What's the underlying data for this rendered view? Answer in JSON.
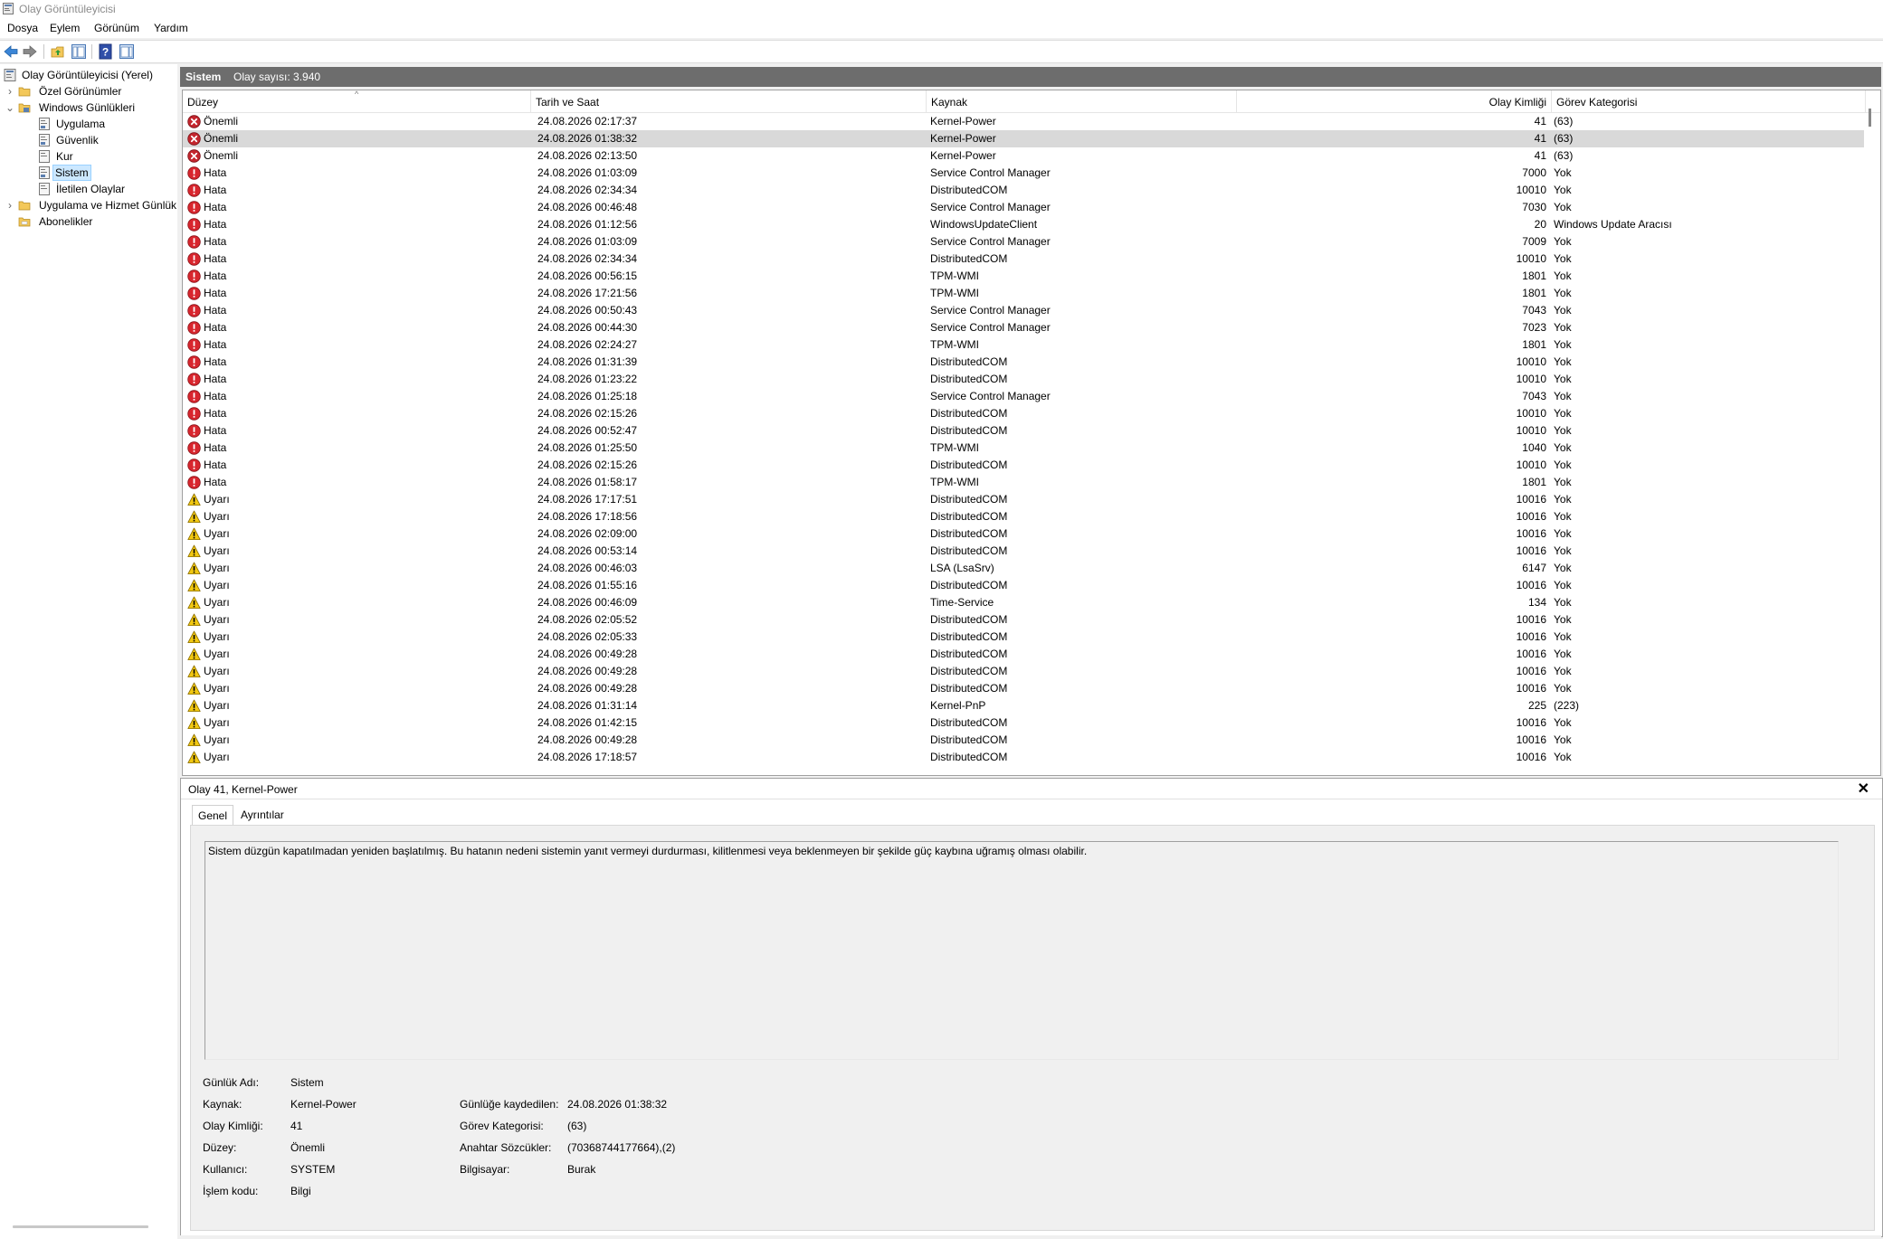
{
  "window": {
    "title": "Olay Görüntüleyicisi"
  },
  "menu": {
    "items": [
      "Dosya",
      "Eylem",
      "Görünüm",
      "Yardım"
    ]
  },
  "toolbar": {
    "buttons": [
      "back-icon",
      "forward-icon",
      "folder-up-icon",
      "show-hide-tree-icon",
      "help-icon",
      "show-hide-action-pane-icon"
    ]
  },
  "tree": {
    "root": "Olay Görüntüleyicisi (Yerel)",
    "custom_views": "Özel Görünümler",
    "windows_logs": "Windows Günlükleri",
    "log_application": "Uygulama",
    "log_security": "Güvenlik",
    "log_setup": "Kur",
    "log_system": "Sistem",
    "log_forwarded": "İletilen Olaylar",
    "app_service_logs": "Uygulama ve Hizmet Günlük",
    "subscriptions": "Abonelikler"
  },
  "list_header": {
    "title": "Sistem",
    "count": "Olay sayısı: 3.940"
  },
  "columns": {
    "level": "Düzey",
    "date": "Tarih ve Saat",
    "source": "Kaynak",
    "event_id": "Olay Kimliği",
    "category": "Görev Kategorisi"
  },
  "events": {
    "rows": [
      {
        "level_type": "critical",
        "level": "Önemli",
        "date": "24.08.2026 02:17:37",
        "source": "Kernel-Power",
        "id": "41",
        "category": "(63)"
      },
      {
        "level_type": "critical",
        "level": "Önemli",
        "date": "24.08.2026 01:38:32",
        "source": "Kernel-Power",
        "id": "41",
        "category": "(63)"
      },
      {
        "level_type": "critical",
        "level": "Önemli",
        "date": "24.08.2026 02:13:50",
        "source": "Kernel-Power",
        "id": "41",
        "category": "(63)"
      },
      {
        "level_type": "error",
        "level": "Hata",
        "date": "24.08.2026 01:03:09",
        "source": "Service Control Manager",
        "id": "7000",
        "category": "Yok"
      },
      {
        "level_type": "error",
        "level": "Hata",
        "date": "24.08.2026 02:34:34",
        "source": "DistributedCOM",
        "id": "10010",
        "category": "Yok"
      },
      {
        "level_type": "error",
        "level": "Hata",
        "date": "24.08.2026 00:46:48",
        "source": "Service Control Manager",
        "id": "7030",
        "category": "Yok"
      },
      {
        "level_type": "error",
        "level": "Hata",
        "date": "24.08.2026 01:12:56",
        "source": "WindowsUpdateClient",
        "id": "20",
        "category": "Windows Update Aracısı"
      },
      {
        "level_type": "error",
        "level": "Hata",
        "date": "24.08.2026 01:03:09",
        "source": "Service Control Manager",
        "id": "7009",
        "category": "Yok"
      },
      {
        "level_type": "error",
        "level": "Hata",
        "date": "24.08.2026 02:34:34",
        "source": "DistributedCOM",
        "id": "10010",
        "category": "Yok"
      },
      {
        "level_type": "error",
        "level": "Hata",
        "date": "24.08.2026 00:56:15",
        "source": "TPM-WMI",
        "id": "1801",
        "category": "Yok"
      },
      {
        "level_type": "error",
        "level": "Hata",
        "date": "24.08.2026 17:21:56",
        "source": "TPM-WMI",
        "id": "1801",
        "category": "Yok"
      },
      {
        "level_type": "error",
        "level": "Hata",
        "date": "24.08.2026 00:50:43",
        "source": "Service Control Manager",
        "id": "7043",
        "category": "Yok"
      },
      {
        "level_type": "error",
        "level": "Hata",
        "date": "24.08.2026 00:44:30",
        "source": "Service Control Manager",
        "id": "7023",
        "category": "Yok"
      },
      {
        "level_type": "error",
        "level": "Hata",
        "date": "24.08.2026 02:24:27",
        "source": "TPM-WMI",
        "id": "1801",
        "category": "Yok"
      },
      {
        "level_type": "error",
        "level": "Hata",
        "date": "24.08.2026 01:31:39",
        "source": "DistributedCOM",
        "id": "10010",
        "category": "Yok"
      },
      {
        "level_type": "error",
        "level": "Hata",
        "date": "24.08.2026 01:23:22",
        "source": "DistributedCOM",
        "id": "10010",
        "category": "Yok"
      },
      {
        "level_type": "error",
        "level": "Hata",
        "date": "24.08.2026 01:25:18",
        "source": "Service Control Manager",
        "id": "7043",
        "category": "Yok"
      },
      {
        "level_type": "error",
        "level": "Hata",
        "date": "24.08.2026 02:15:26",
        "source": "DistributedCOM",
        "id": "10010",
        "category": "Yok"
      },
      {
        "level_type": "error",
        "level": "Hata",
        "date": "24.08.2026 00:52:47",
        "source": "DistributedCOM",
        "id": "10010",
        "category": "Yok"
      },
      {
        "level_type": "error",
        "level": "Hata",
        "date": "24.08.2026 01:25:50",
        "source": "TPM-WMI",
        "id": "1040",
        "category": "Yok"
      },
      {
        "level_type": "error",
        "level": "Hata",
        "date": "24.08.2026 02:15:26",
        "source": "DistributedCOM",
        "id": "10010",
        "category": "Yok"
      },
      {
        "level_type": "error",
        "level": "Hata",
        "date": "24.08.2026 01:58:17",
        "source": "TPM-WMI",
        "id": "1801",
        "category": "Yok"
      },
      {
        "level_type": "warning",
        "level": "Uyarı",
        "date": "24.08.2026 17:17:51",
        "source": "DistributedCOM",
        "id": "10016",
        "category": "Yok"
      },
      {
        "level_type": "warning",
        "level": "Uyarı",
        "date": "24.08.2026 17:18:56",
        "source": "DistributedCOM",
        "id": "10016",
        "category": "Yok"
      },
      {
        "level_type": "warning",
        "level": "Uyarı",
        "date": "24.08.2026 02:09:00",
        "source": "DistributedCOM",
        "id": "10016",
        "category": "Yok"
      },
      {
        "level_type": "warning",
        "level": "Uyarı",
        "date": "24.08.2026 00:53:14",
        "source": "DistributedCOM",
        "id": "10016",
        "category": "Yok"
      },
      {
        "level_type": "warning",
        "level": "Uyarı",
        "date": "24.08.2026 00:46:03",
        "source": "LSA (LsaSrv)",
        "id": "6147",
        "category": "Yok"
      },
      {
        "level_type": "warning",
        "level": "Uyarı",
        "date": "24.08.2026 01:55:16",
        "source": "DistributedCOM",
        "id": "10016",
        "category": "Yok"
      },
      {
        "level_type": "warning",
        "level": "Uyarı",
        "date": "24.08.2026 00:46:09",
        "source": "Time-Service",
        "id": "134",
        "category": "Yok"
      },
      {
        "level_type": "warning",
        "level": "Uyarı",
        "date": "24.08.2026 02:05:52",
        "source": "DistributedCOM",
        "id": "10016",
        "category": "Yok"
      },
      {
        "level_type": "warning",
        "level": "Uyarı",
        "date": "24.08.2026 02:05:33",
        "source": "DistributedCOM",
        "id": "10016",
        "category": "Yok"
      },
      {
        "level_type": "warning",
        "level": "Uyarı",
        "date": "24.08.2026 00:49:28",
        "source": "DistributedCOM",
        "id": "10016",
        "category": "Yok"
      },
      {
        "level_type": "warning",
        "level": "Uyarı",
        "date": "24.08.2026 00:49:28",
        "source": "DistributedCOM",
        "id": "10016",
        "category": "Yok"
      },
      {
        "level_type": "warning",
        "level": "Uyarı",
        "date": "24.08.2026 00:49:28",
        "source": "DistributedCOM",
        "id": "10016",
        "category": "Yok"
      },
      {
        "level_type": "warning",
        "level": "Uyarı",
        "date": "24.08.2026 01:31:14",
        "source": "Kernel-PnP",
        "id": "225",
        "category": "(223)"
      },
      {
        "level_type": "warning",
        "level": "Uyarı",
        "date": "24.08.2026 01:42:15",
        "source": "DistributedCOM",
        "id": "10016",
        "category": "Yok"
      },
      {
        "level_type": "warning",
        "level": "Uyarı",
        "date": "24.08.2026 00:49:28",
        "source": "DistributedCOM",
        "id": "10016",
        "category": "Yok"
      },
      {
        "level_type": "warning",
        "level": "Uyarı",
        "date": "24.08.2026 17:18:57",
        "source": "DistributedCOM",
        "id": "10016",
        "category": "Yok"
      }
    ]
  },
  "detail": {
    "title": "Olay 41, Kernel-Power",
    "tab_general": "Genel",
    "tab_details": "Ayrıntılar",
    "description": "Sistem düzgün kapatılmadan yeniden başlatılmış. Bu hatanın nedeni sistemin yanıt vermeyi durdurması, kilitlenmesi veya beklenmeyen bir şekilde güç kaybına uğramış olması olabilir.",
    "log_name_label": "Günlük Adı:",
    "log_name": "Sistem",
    "source_label": "Kaynak:",
    "source": "Kernel-Power",
    "event_id_label": "Olay Kimliği:",
    "event_id": "41",
    "level_label": "Düzey:",
    "level": "Önemli",
    "user_label": "Kullanıcı:",
    "user": "SYSTEM",
    "opcode_label": "İşlem kodu:",
    "opcode": "Bilgi",
    "logged_label": "Günlüğe kaydedilen:",
    "logged": "24.08.2026 01:38:32",
    "category_label": "Görev Kategorisi:",
    "category": "(63)",
    "keywords_label": "Anahtar Sözcükler:",
    "keywords": "(70368744177664),(2)",
    "computer_label": "Bilgisayar:",
    "computer": "Burak"
  },
  "colors": {
    "header_strip": "#6d6d6d",
    "selected_row": "#d9d9d9",
    "critical": "#c4262e",
    "warning": "#f2c811"
  }
}
